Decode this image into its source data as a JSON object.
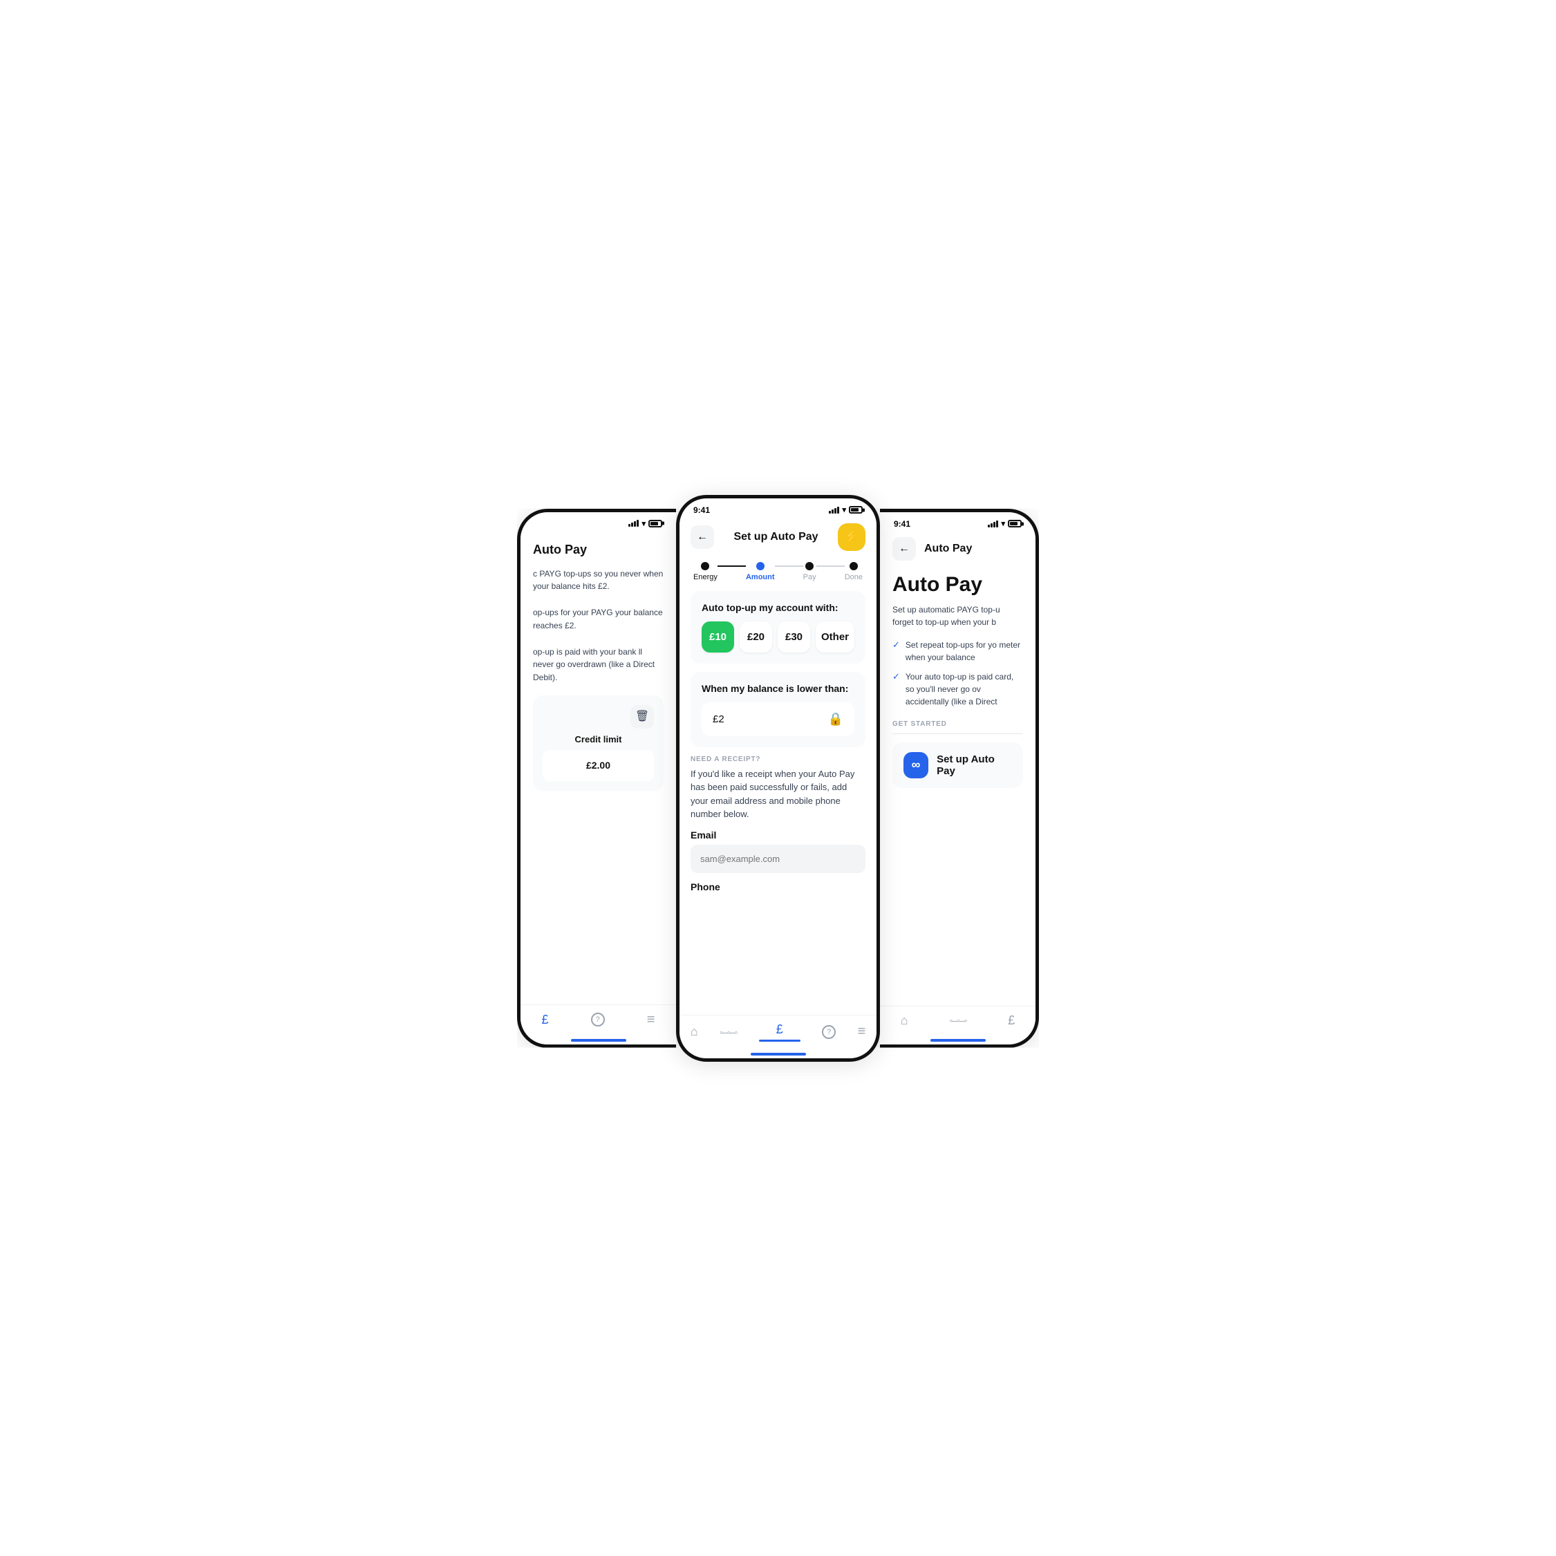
{
  "left_phone": {
    "status": {
      "time": "",
      "signal": true,
      "wifi": true,
      "battery": true
    },
    "title": "Auto Pay",
    "body_text_1": "c PAYG top-ups so you never when your balance hits £2.",
    "body_text_2": "op-ups for your PAYG your balance reaches £2.",
    "body_text_3": "op-up is paid with your bank ll never go overdrawn (like a Direct Debit).",
    "credit_card": {
      "trash_icon": "🗑",
      "label": "Credit limit",
      "value": "£2.00"
    },
    "nav": {
      "items": [
        {
          "icon": "£",
          "label": "",
          "active": true
        },
        {
          "icon": "?",
          "label": "",
          "active": false
        },
        {
          "icon": "≡",
          "label": "",
          "active": false
        }
      ]
    }
  },
  "center_phone": {
    "status": {
      "time": "9:41",
      "signal": true,
      "wifi": true,
      "battery": true
    },
    "header": {
      "back_label": "←",
      "title": "Set up Auto Pay",
      "action_icon": "⚡"
    },
    "stepper": {
      "steps": [
        {
          "label": "Energy",
          "state": "done"
        },
        {
          "label": "Amount",
          "state": "active"
        },
        {
          "label": "Pay",
          "state": "upcoming"
        },
        {
          "label": "Done",
          "state": "upcoming"
        }
      ]
    },
    "top_up_card": {
      "title": "Auto top-up my account with:",
      "options": [
        {
          "value": "£10",
          "selected": true
        },
        {
          "value": "£20",
          "selected": false
        },
        {
          "value": "£30",
          "selected": false
        },
        {
          "value": "Other",
          "selected": false
        }
      ]
    },
    "balance_card": {
      "title": "When my balance is lower than:",
      "value": "£2",
      "lock_icon": "🔒"
    },
    "receipt": {
      "section_label": "NEED A RECEIPT?",
      "description": "If you'd like a receipt when your Auto Pay has been paid successfully or fails, add your email address and mobile phone number below.",
      "email_label": "Email",
      "email_placeholder": "sam@example.com",
      "phone_label": "Phone"
    },
    "nav": {
      "items": [
        {
          "icon": "⌂",
          "active": false
        },
        {
          "icon": "◦◦◦",
          "active": false
        },
        {
          "icon": "£",
          "active": true
        },
        {
          "icon": "?",
          "active": false
        },
        {
          "icon": "≡",
          "active": false
        }
      ]
    }
  },
  "right_phone": {
    "status": {
      "time": "9:41",
      "signal": true,
      "wifi": true,
      "battery": true
    },
    "header": {
      "back_label": "←",
      "title": "Auto Pay"
    },
    "heading": "Auto Pay",
    "description": "Set up automatic PAYG top-u forget to top-up when your b",
    "check_items": [
      "Set repeat top-ups for yo meter when your balance",
      "Your auto top-up is paid card, so you'll never go ov accidentally (like a Direct"
    ],
    "get_started_label": "GET STARTED",
    "setup_button": {
      "icon": "∞",
      "label": "Set up Auto Pay"
    },
    "nav": {
      "items": [
        {
          "icon": "⌂",
          "active": false
        },
        {
          "icon": "◦◦◦",
          "active": false
        },
        {
          "icon": "£",
          "active": false
        }
      ]
    }
  }
}
